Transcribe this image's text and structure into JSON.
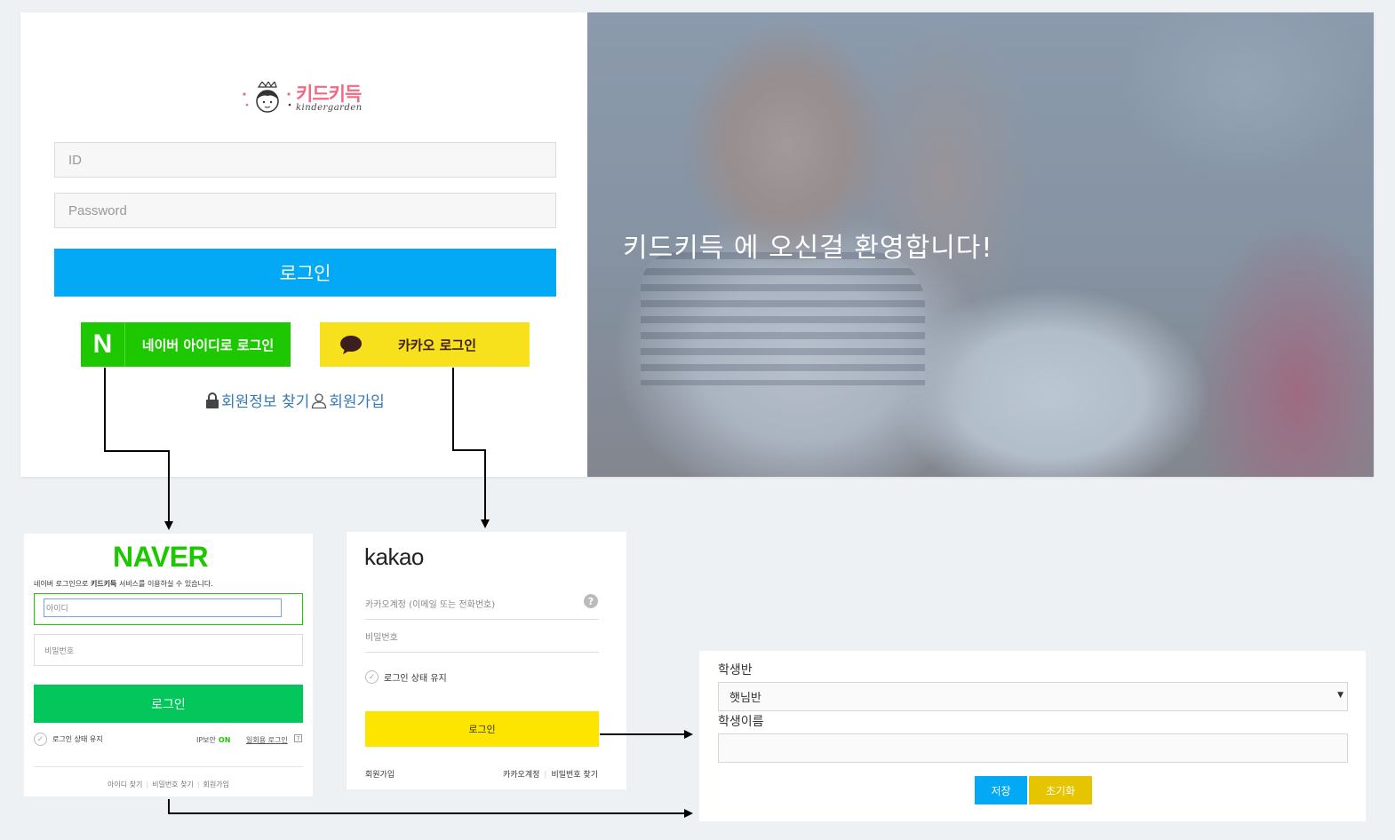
{
  "main": {
    "brand": {
      "name": "키드키득",
      "sub": "kindergarden"
    },
    "id_placeholder": "ID",
    "password_placeholder": "Password",
    "login_label": "로그인",
    "naver_login_label": "네이버 아이디로 로그인",
    "naver_mark": "N",
    "kakao_login_label": "카카오 로그인",
    "find_account_label": "회원정보 찾기",
    "signup_label": "회원가입",
    "welcome_text": "키드키득 에 오신걸 환영합니다!"
  },
  "naver": {
    "logo": "NAVER",
    "desc_prefix": "네이버 로그인으로 ",
    "desc_service": "키드키득",
    "desc_suffix": " 서비스를 이용하실 수 있습니다.",
    "id_placeholder": "아이디",
    "pw_placeholder": "비밀번호",
    "login_label": "로그인",
    "keep_label": "로그인 상태 유지",
    "ip_label": "IP보안",
    "ip_state": "ON",
    "once_label": "일회용 로그인",
    "help_mark": "?",
    "footer": [
      "아이디 찾기",
      "비밀번호 찾기",
      "회원가입"
    ]
  },
  "kakao": {
    "logo": "kakao",
    "account_placeholder": "카카오계정 (이메일 또는 전화번호)",
    "help_mark": "?",
    "pw_placeholder": "비밀번호",
    "keep_label": "로그인 상태 유지",
    "login_label": "로그인",
    "signup_label": "회원가입",
    "account_label": "카카오계정",
    "find_pw_label": "비밀번호 찾기"
  },
  "student_form": {
    "class_label": "학생반",
    "class_value": "햇님반",
    "name_label": "학생이름",
    "name_value": "",
    "save_label": "저장",
    "reset_label": "초기화"
  },
  "colors": {
    "primary": "#03a9f4",
    "naver_green": "#1ec800",
    "kakao_yellow": "#f7e01c",
    "brand_pink": "#f06a84"
  }
}
